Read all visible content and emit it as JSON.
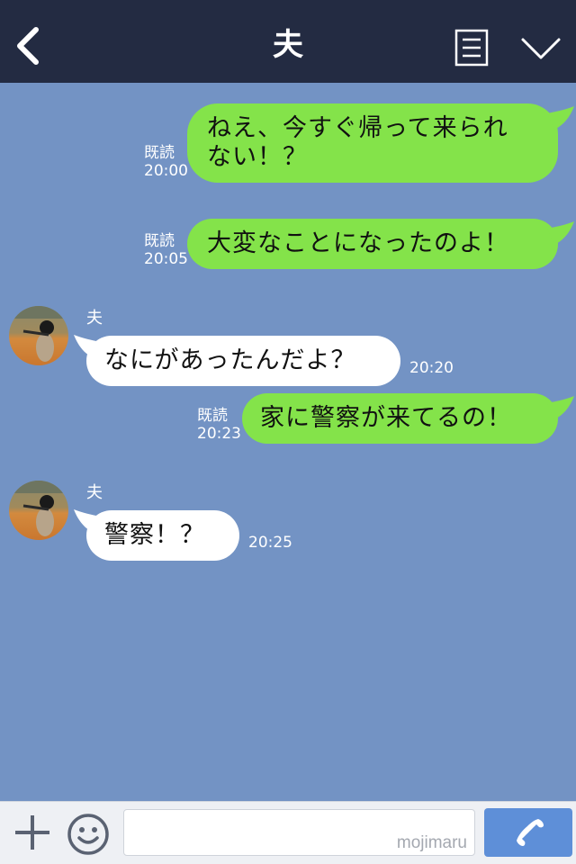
{
  "header": {
    "title": "夫",
    "back_icon": "chevron-left-icon",
    "notes_icon": "notes-icon",
    "menu_icon": "chevron-down-icon"
  },
  "messages": [
    {
      "direction": "sent",
      "text_line1": "ねえ、今すぐ帰って来られ",
      "text_line2": "ない！？",
      "read": "既読",
      "time": "20:00"
    },
    {
      "direction": "sent",
      "text": "大変なことになったのよ！",
      "read": "既読",
      "time": "20:05"
    },
    {
      "direction": "received",
      "sender": "夫",
      "text": "なにがあったんだよ？",
      "time": "20:20"
    },
    {
      "direction": "sent",
      "text": "家に警察が来てるの！",
      "read": "既読",
      "time": "20:23"
    },
    {
      "direction": "received",
      "sender": "夫",
      "text": "警察！？",
      "time": "20:25"
    }
  ],
  "bottom_bar": {
    "plus_icon": "plus-icon",
    "emoji_icon": "smiley-icon",
    "input_value": "",
    "watermark": "mojimaru",
    "call_icon": "phone-icon"
  },
  "colors": {
    "header_bg": "#232b42",
    "chat_bg": "#7393c4",
    "sent_bubble": "#84e34a",
    "received_bubble": "#ffffff",
    "call_button": "#5e8fd8"
  }
}
